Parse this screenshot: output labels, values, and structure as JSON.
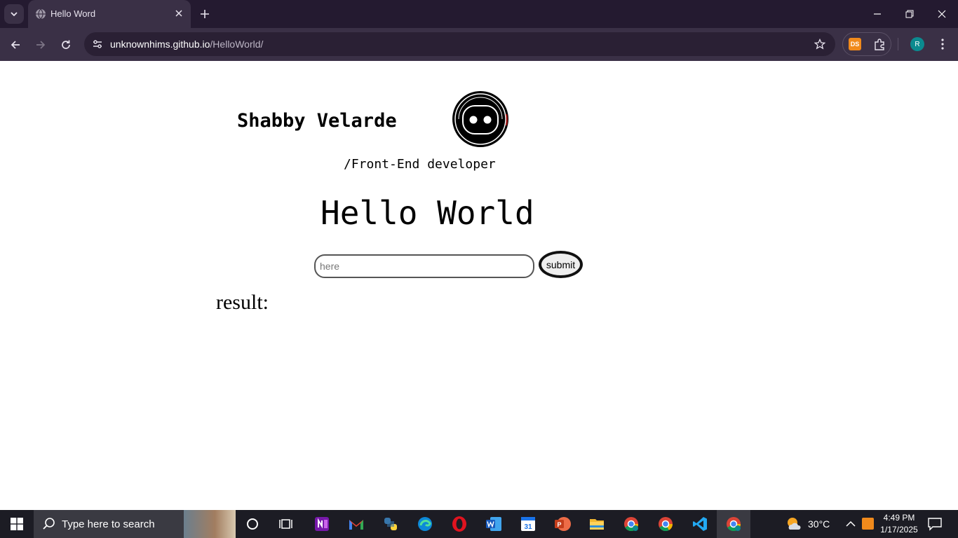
{
  "browser": {
    "tab_title": "Hello Word",
    "url_host": "unknownhims.github.io",
    "url_path": "/HelloWorld/",
    "profile_initial": "R",
    "extension_label": "DS"
  },
  "page": {
    "name": "Shabby Velarde",
    "role": "/Front-End developer",
    "heading": "Hello World",
    "input_placeholder": "here",
    "input_value": "",
    "submit_label": "submit",
    "result_label": "result:"
  },
  "taskbar": {
    "search_placeholder": "Type here to search",
    "temperature": "30°C",
    "time": "4:49 PM",
    "date": "1/17/2025",
    "pinned_apps": [
      "cortana",
      "task-view",
      "onenote",
      "gmail",
      "python",
      "edge",
      "opera",
      "word",
      "calendar",
      "powerpoint",
      "file-explorer",
      "chrome-profile",
      "chrome",
      "vscode",
      "chrome-active"
    ]
  },
  "colors": {
    "chrome_dark": "#241a30",
    "toolbar": "#3a3046",
    "taskbar": "#1c1c24",
    "page_bg": "#ffffff"
  }
}
